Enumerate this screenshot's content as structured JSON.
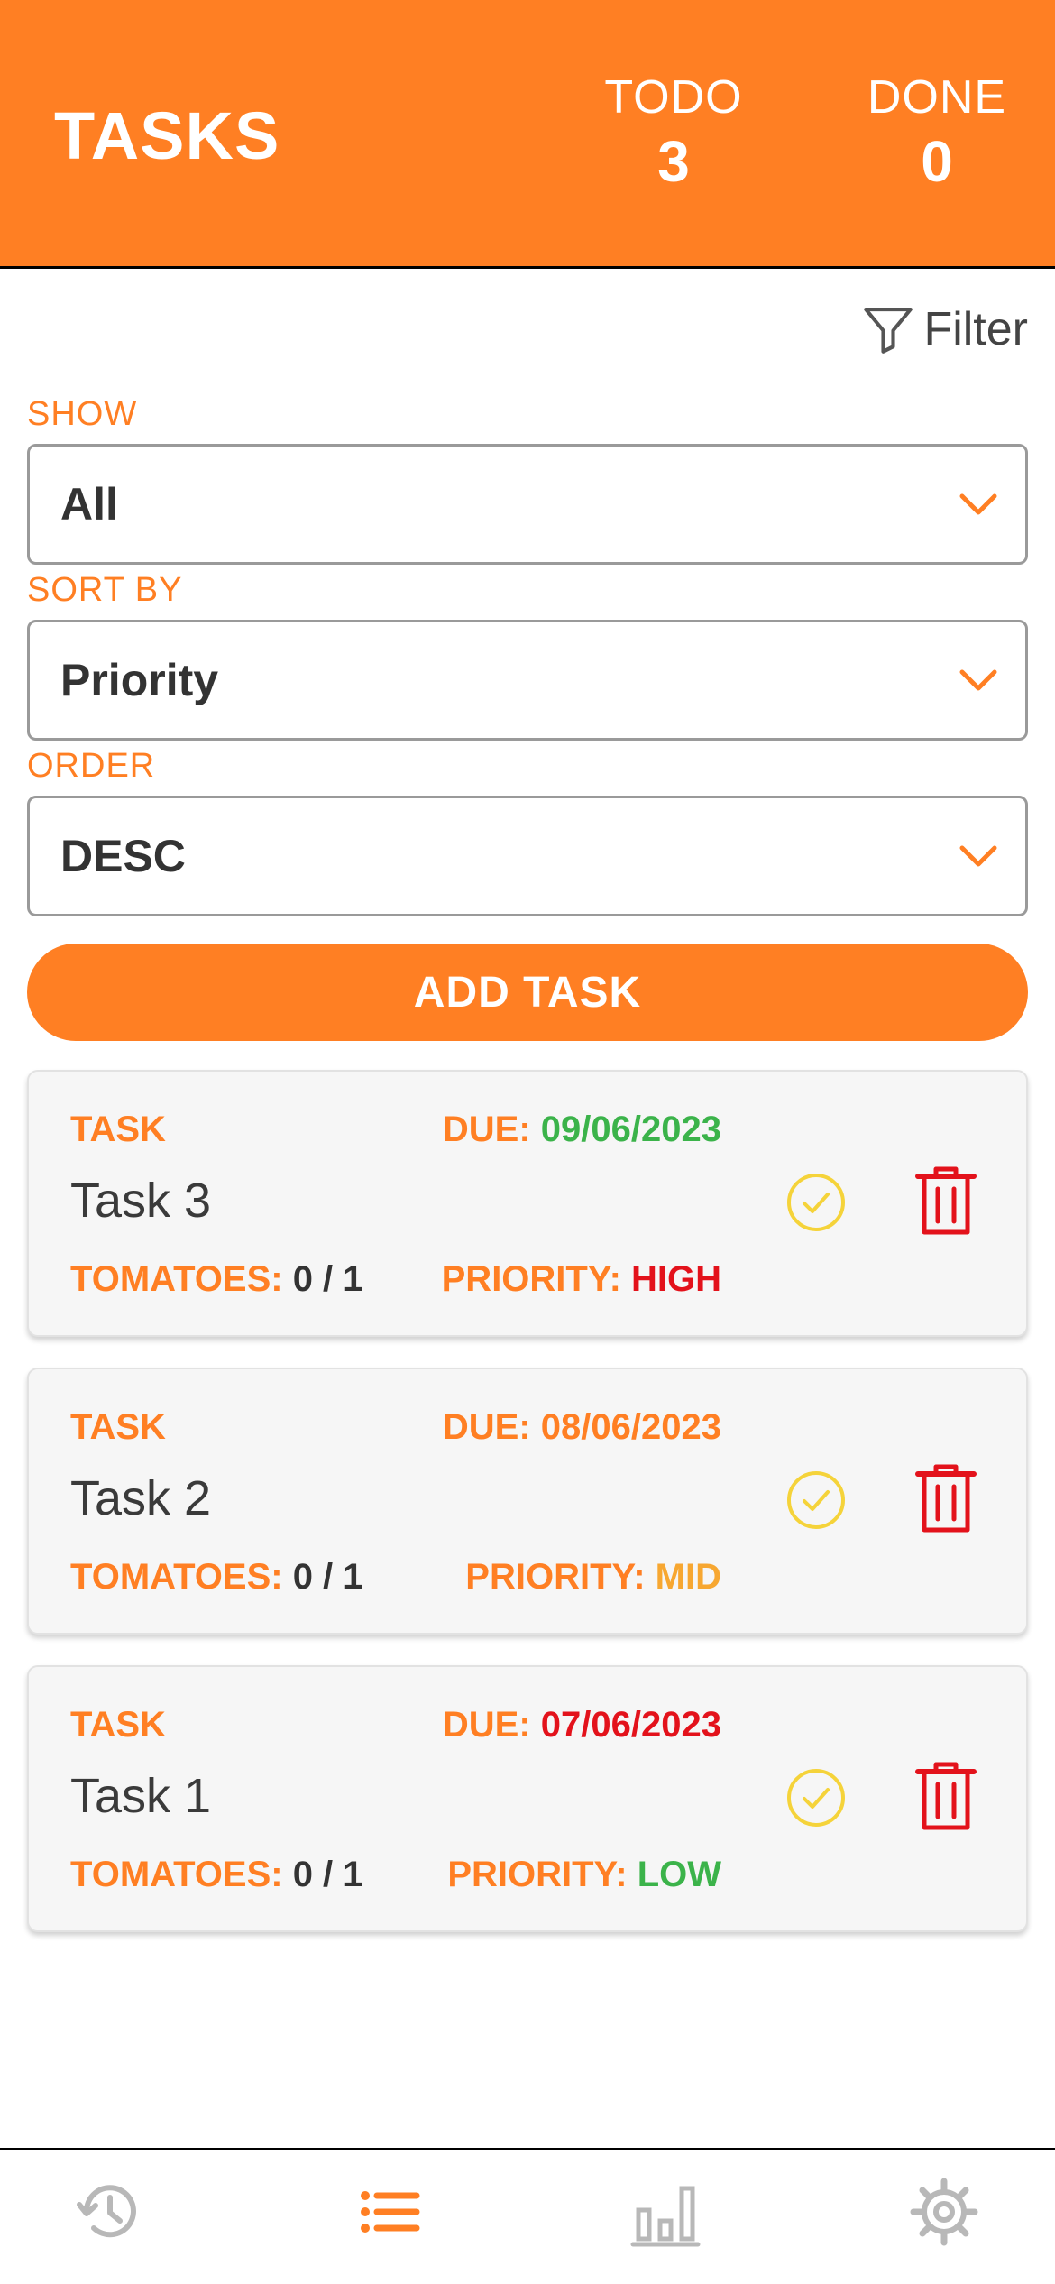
{
  "header": {
    "title": "TASKS",
    "todo_label": "TODO",
    "todo_count": "3",
    "done_label": "DONE",
    "done_count": "0"
  },
  "filter": {
    "label": "Filter",
    "icon": "filter-icon"
  },
  "fields": {
    "show": {
      "label": "SHOW",
      "value": "All"
    },
    "sort_by": {
      "label": "SORT BY",
      "value": "Priority"
    },
    "order": {
      "label": "ORDER",
      "value": "DESC"
    }
  },
  "add_button": "ADD TASK",
  "tasks": [
    {
      "task_label": "TASK",
      "due_label": "DUE: ",
      "due": "09/06/2023",
      "due_color": "#3BB34A",
      "name": "Task 3",
      "tomatoes_label": "TOMATOES: ",
      "tomatoes": "0 / 1",
      "priority_label": "PRIORITY: ",
      "priority": "HIGH",
      "priority_color": "#E3121B"
    },
    {
      "task_label": "TASK",
      "due_label": "DUE: ",
      "due": "08/06/2023",
      "due_color": "#FF7F23",
      "name": "Task 2",
      "tomatoes_label": "TOMATOES: ",
      "tomatoes": "0 / 1",
      "priority_label": "PRIORITY: ",
      "priority": "MID",
      "priority_color": "#F7A731"
    },
    {
      "task_label": "TASK",
      "due_label": "DUE: ",
      "due": "07/06/2023",
      "due_color": "#E3121B",
      "name": "Task 1",
      "tomatoes_label": "TOMATOES: ",
      "tomatoes": "0 / 1",
      "priority_label": "PRIORITY: ",
      "priority": "LOW",
      "priority_color": "#3BB34A"
    }
  ],
  "navbar": {
    "items": [
      {
        "icon": "history-icon",
        "active": false
      },
      {
        "icon": "list-icon",
        "active": true
      },
      {
        "icon": "bar-chart-icon",
        "active": false
      },
      {
        "icon": "gear-icon",
        "active": false
      }
    ]
  },
  "colors": {
    "accent": "#FF7F23",
    "check": "#F5D33A",
    "trash": "#E3121B",
    "inactive_icon": "#B8B8B8"
  }
}
